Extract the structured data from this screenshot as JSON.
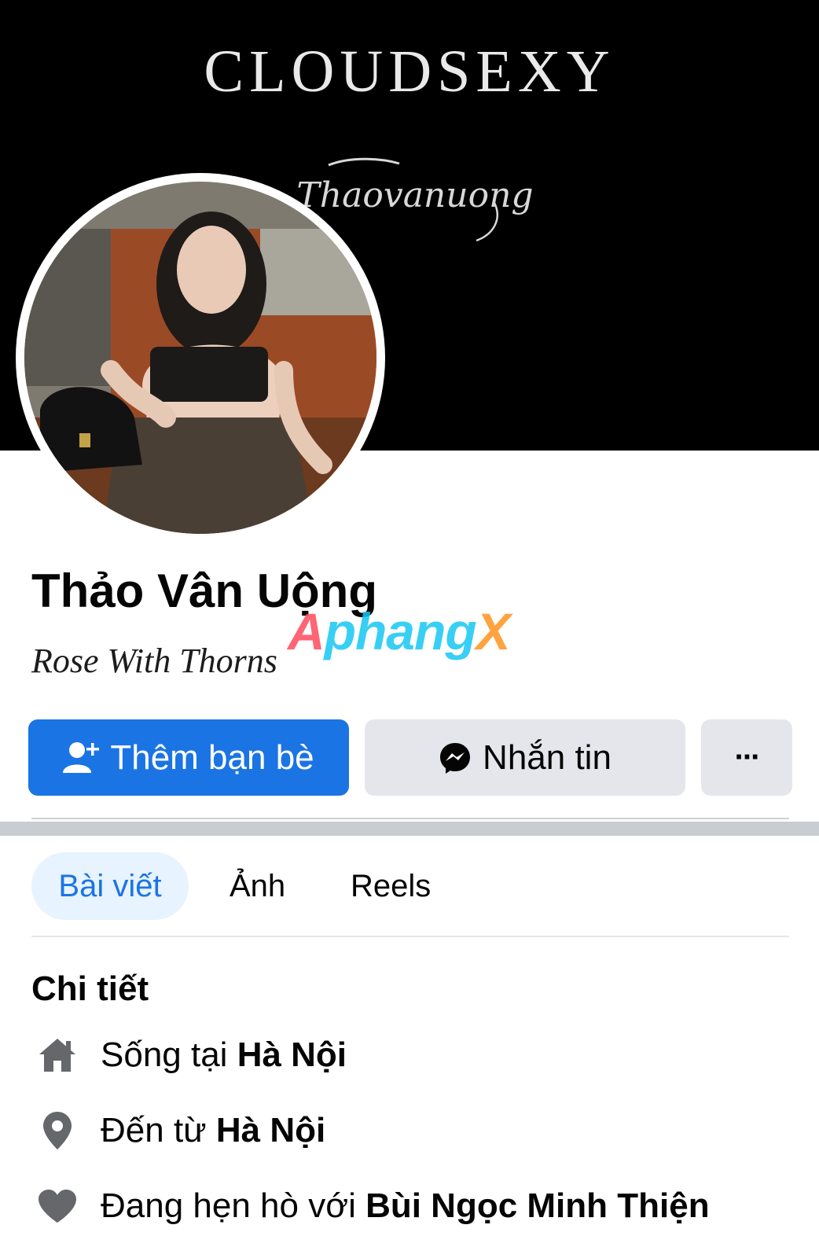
{
  "cover": {
    "brand_text": "CLOUDSEXY",
    "signature_text": "Thaovanuong"
  },
  "profile": {
    "name": "Thảo Vân Uộng",
    "bio": "Rose With Thorns"
  },
  "watermark": {
    "part_a": "A",
    "part_b": "phang",
    "part_c": "X"
  },
  "actions": {
    "add_friend_label": "Thêm bạn bè",
    "message_label": "Nhắn tin",
    "more_label": "···"
  },
  "tabs": [
    {
      "label": "Bài viết",
      "active": true
    },
    {
      "label": "Ảnh",
      "active": false
    },
    {
      "label": "Reels",
      "active": false
    }
  ],
  "details": {
    "title": "Chi tiết",
    "items": [
      {
        "icon": "home-icon",
        "prefix": "Sống tại ",
        "value": "Hà Nội"
      },
      {
        "icon": "location-pin-icon",
        "prefix": "Đến từ ",
        "value": "Hà Nội"
      },
      {
        "icon": "heart-icon",
        "prefix": "Đang hẹn hò với ",
        "value": "Bùi Ngọc Minh Thiện"
      }
    ]
  },
  "colors": {
    "primary": "#1b74e4",
    "secondary_button": "#e4e6eb",
    "active_tab_bg": "#e7f3ff",
    "icon_gray": "#65676b"
  }
}
